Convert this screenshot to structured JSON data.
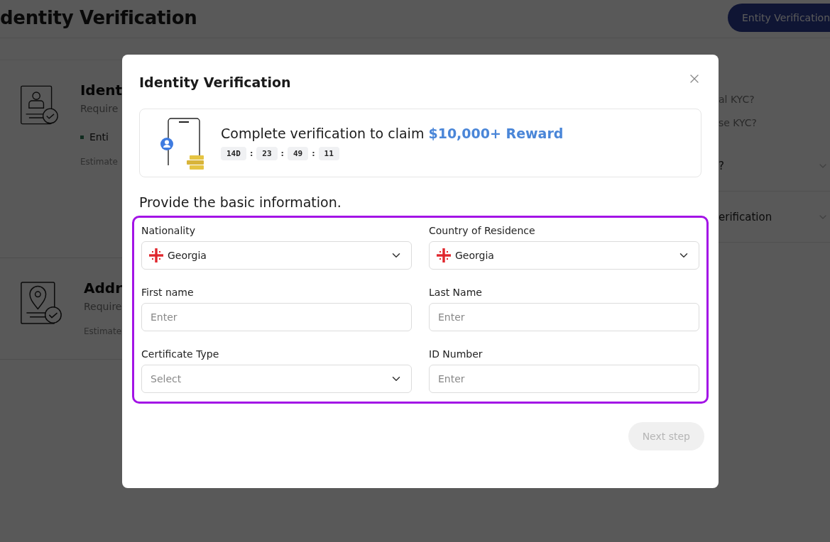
{
  "page": {
    "title": "dentity Verification",
    "header_button": "Entity Verification",
    "cards": [
      {
        "kind": "id",
        "title": "Ident",
        "subtitle": "Require",
        "bullet": "Enti",
        "note": "Estimate"
      },
      {
        "kind": "address",
        "title": "Addr",
        "subtitle": "Require",
        "note": "Estimate"
      }
    ],
    "questions": [
      "al KYC?",
      "se KYC?"
    ],
    "accordion": [
      {
        "label": "?",
        "expanded": false
      },
      {
        "label": "erification",
        "expanded": false
      }
    ]
  },
  "modal": {
    "title": "Identity Verification",
    "banner": {
      "text": "Complete verification to claim ",
      "highlight": "$10,000+ Reward",
      "countdown": [
        {
          "kind": "unit",
          "text": "14D"
        },
        {
          "kind": "sep",
          "text": ":"
        },
        {
          "kind": "unit",
          "text": "23"
        },
        {
          "kind": "sep",
          "text": ":"
        },
        {
          "kind": "unit",
          "text": "49"
        },
        {
          "kind": "sep",
          "text": ":"
        },
        {
          "kind": "unit",
          "text": "11"
        }
      ]
    },
    "section_title": "Provide the basic information.",
    "form_highlighted": true,
    "fields": [
      {
        "label": "Nationality",
        "kind": "country",
        "value": "Georgia"
      },
      {
        "label": "Country of Residence",
        "kind": "country",
        "value": "Georgia"
      },
      {
        "label": "First name",
        "kind": "text",
        "placeholder": "Enter"
      },
      {
        "label": "Last Name",
        "kind": "text",
        "placeholder": "Enter"
      },
      {
        "label": "Certificate Type",
        "kind": "select",
        "placeholder": "Select"
      },
      {
        "label": "ID Number",
        "kind": "text",
        "placeholder": "Enter"
      }
    ],
    "next_button": {
      "label": "Next step",
      "disabled": true
    }
  }
}
